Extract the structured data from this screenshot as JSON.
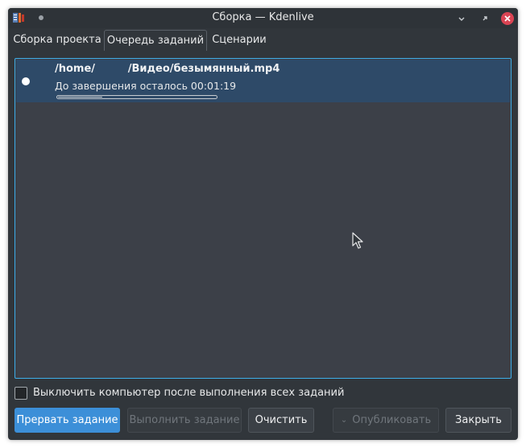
{
  "window": {
    "title": "Сборка — Kdenlive"
  },
  "tabs": [
    {
      "label": "Сборка проекта"
    },
    {
      "label": "Очередь заданий"
    },
    {
      "label": "Сценарии"
    }
  ],
  "active_tab": "Очередь заданий",
  "jobs": [
    {
      "path": "/home/         /Видео/безымянный.mp4",
      "status": "До завершения осталось 00:01:19",
      "progress": 0.28
    }
  ],
  "shutdown_option": {
    "label": "Выключить компьютер после выполнения всех заданий",
    "checked": false
  },
  "buttons": {
    "abort": "Прервать задание",
    "run": "Выполнить задание",
    "clear": "Очистить",
    "publish": "Опубликовать",
    "close": "Закрыть"
  },
  "colors": {
    "accent": "#3daee9",
    "window_bg": "#31363b",
    "selected_row": "#2e4a68",
    "close_button": "#da4453"
  },
  "icons": {
    "app": "kdenlive-app-icon",
    "pin": "pin-icon",
    "minimize": "minimize-icon",
    "maximize": "maximize-icon",
    "close": "close-icon",
    "job_status": "running-dot-icon",
    "publish_menu": "chevron-down-icon",
    "cursor": "mouse-pointer-icon"
  }
}
